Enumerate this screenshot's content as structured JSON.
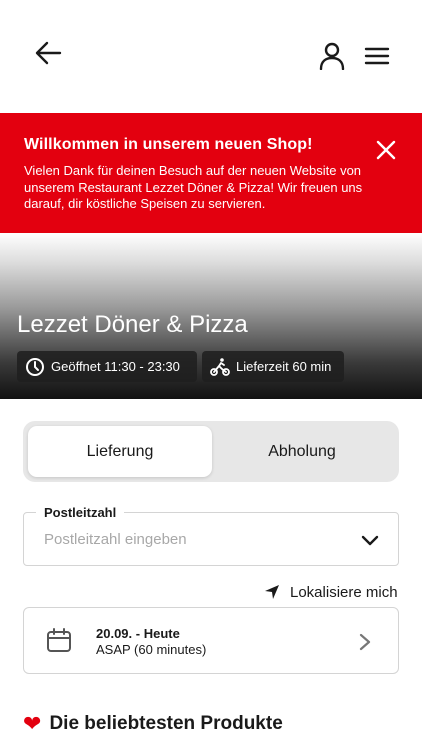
{
  "header": {
    "back_icon": "arrow-left-icon",
    "user_icon": "user-icon",
    "menu_icon": "hamburger-menu-icon"
  },
  "banner": {
    "title": "Willkommen in unserem neuen Shop!",
    "text": "Vielen Dank für deinen Besuch auf der neuen Website von unserem Restaurant Lezzet Döner & Pizza! Wir freuen uns darauf, dir köstliche Speisen zu servieren.",
    "background": "#e3000f",
    "close_icon": "close-icon"
  },
  "restaurant": {
    "name": "Lezzet Döner & Pizza",
    "opening_hours": "Geöffnet 11:30 - 23:30",
    "delivery_time": "Lieferzeit 60 min"
  },
  "order_mode": {
    "options": [
      "Lieferung",
      "Abholung"
    ],
    "selected": "Lieferung"
  },
  "postal_code": {
    "label": "Postleitzahl",
    "placeholder": "Postleitzahl eingeben",
    "value": ""
  },
  "locate": {
    "label": "Lokalisiere mich"
  },
  "schedule": {
    "date": "20.09. - Heute",
    "time": "ASAP (60 minutes)"
  },
  "popular": {
    "heading": "Die beliebtesten Produkte"
  }
}
